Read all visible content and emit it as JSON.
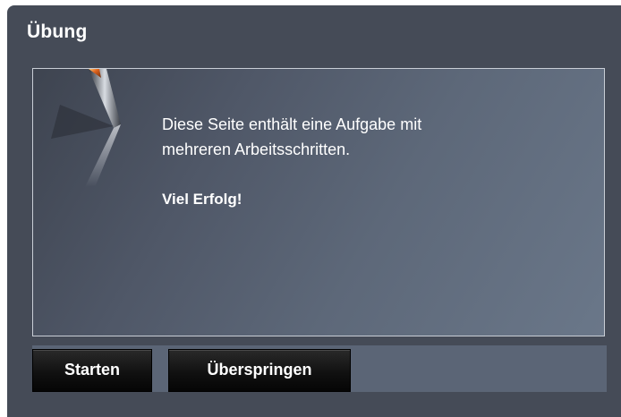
{
  "dialog": {
    "title": "Übung"
  },
  "content": {
    "line1": "Diese Seite enthält eine Aufgabe mit",
    "line2": "mehreren Arbeitsschritten.",
    "closing": "Viel Erfolg!"
  },
  "buttons": {
    "start_label": "Starten",
    "skip_label": "Überspringen"
  },
  "colors": {
    "dialog_bg": "#454b57",
    "panel_border": "#c9ced6",
    "button_bg": "#111111",
    "text": "#ffffff"
  },
  "icons": {
    "decoration": "pen-nib-icon"
  }
}
